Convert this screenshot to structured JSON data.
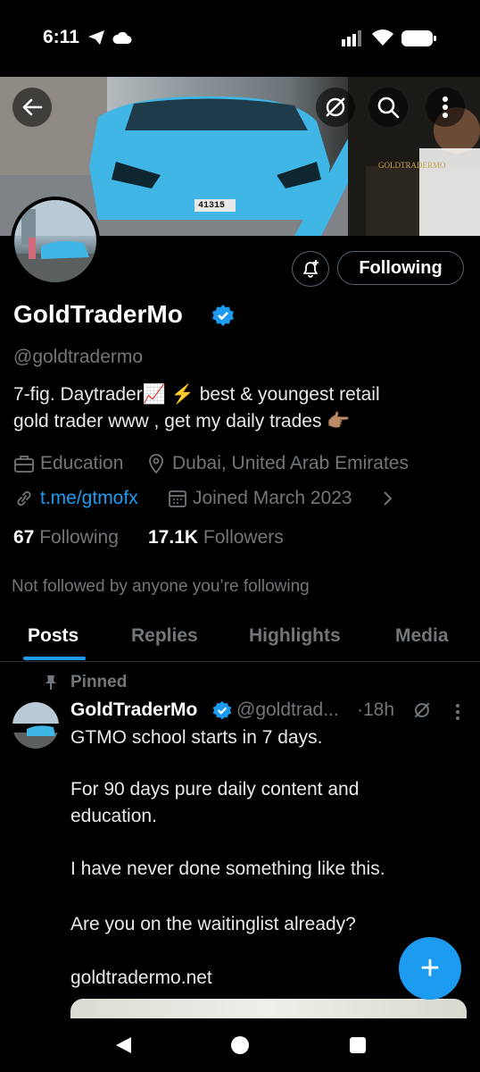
{
  "status_bar": {
    "time": "6:11"
  },
  "banner": {
    "plate": "41315",
    "sign_text": "GOLDTRADERMO"
  },
  "profile": {
    "name": "GoldTraderMo",
    "handle": "@goldtradermo",
    "bio_line1": "7-fig. Daytrader📈 ⚡ best & youngest retail",
    "bio_line2": "gold trader www , get my daily trades 👉🏽",
    "category": "Education",
    "location": "Dubai, United Arab Emirates",
    "link": "t.me/gtmofx",
    "joined": "Joined March 2023",
    "following_count": "67",
    "following_label": "Following",
    "followers_count": "17.1K",
    "followers_label": "Followers",
    "not_followed_text": "Not followed by anyone you’re following",
    "follow_button": "Following"
  },
  "tabs": [
    "Posts",
    "Replies",
    "Highlights",
    "Media"
  ],
  "post": {
    "pinned_label": "Pinned",
    "author": "GoldTraderMo",
    "handle": "@goldtrad...",
    "time": "·18h",
    "lines": [
      "GTMO school starts in 7 days.",
      "For 90 days pure daily content and",
      "education.",
      "I have never done something like this.",
      "Are you on the waitinglist already?"
    ],
    "link": "goldtradermo.net"
  },
  "fab_label": "+",
  "colors": {
    "accent": "#1d9bf0",
    "background": "#000000",
    "muted": "#71767b"
  }
}
